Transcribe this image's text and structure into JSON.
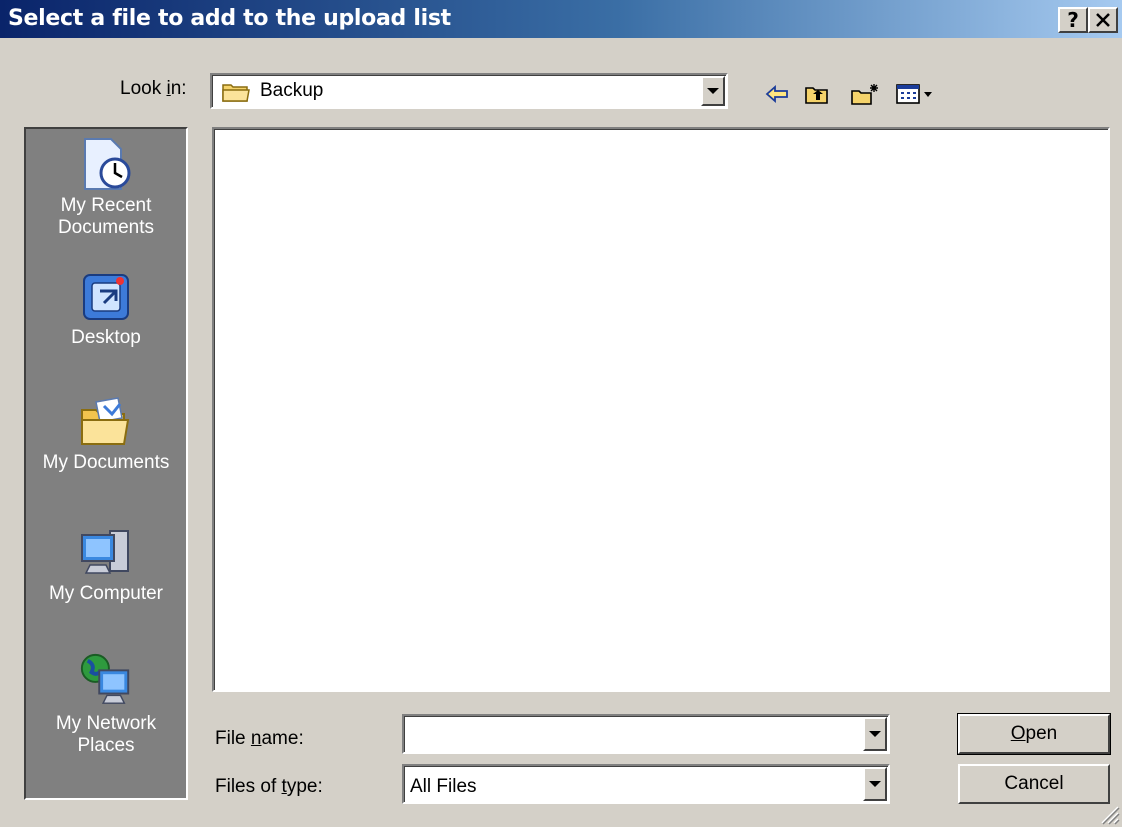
{
  "window": {
    "title": "Select a file to add to the upload list",
    "help_label": "?",
    "close_label": "✕"
  },
  "lookin": {
    "label": "Look in:",
    "mnemonic": "i",
    "value": "Backup"
  },
  "toolbar": {
    "icons": [
      "back-arrow-icon",
      "up-one-level-icon",
      "create-new-folder-icon",
      "view-menu-icon"
    ]
  },
  "places": [
    {
      "label": "My Recent Documents",
      "icon": "recent-documents-icon"
    },
    {
      "label": "Desktop",
      "icon": "desktop-icon"
    },
    {
      "label": "My Documents",
      "icon": "my-documents-icon"
    },
    {
      "label": "My Computer",
      "icon": "my-computer-icon"
    },
    {
      "label": "My Network Places",
      "icon": "network-places-icon"
    }
  ],
  "filename": {
    "label": "File name:",
    "value": ""
  },
  "filetype": {
    "label": "Files of type:",
    "value": "All Files"
  },
  "buttons": {
    "open": "Open",
    "cancel": "Cancel"
  },
  "colors": {
    "title_start": "#0a246a",
    "title_end": "#a6caf0",
    "face": "#d4d0c8",
    "places_bg": "#808080"
  }
}
